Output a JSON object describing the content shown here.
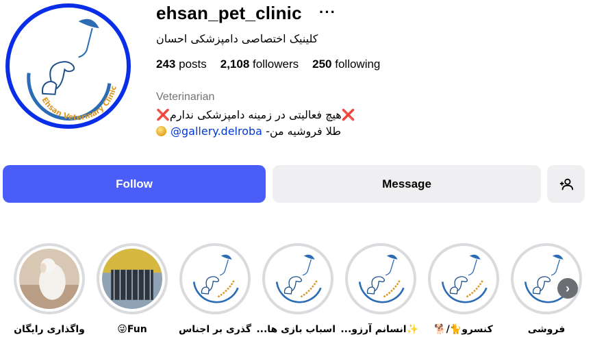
{
  "profile": {
    "username": "ehsan_pet_clinic",
    "more_icon": "more-horizontal-icon",
    "full_name": "کلینیک اختصاصی دامپزشکی احسان",
    "avatar_text": "Ehsan Veterinary Clinic"
  },
  "stats": {
    "posts_count": "243",
    "posts_label": "posts",
    "followers_count": "2,108",
    "followers_label": "followers",
    "following_count": "250",
    "following_label": "following"
  },
  "bio": {
    "category": "Veterinarian",
    "line1_text": "هیچ فعالیتی در زمینه دامپزشکی ندارم",
    "line1_mark": "❌",
    "line2_text": "طلا فروشیه من-",
    "line2_link": "@gallery.delroba"
  },
  "actions": {
    "follow_label": "Follow",
    "message_label": "Message",
    "add_user_icon": "add-user-icon"
  },
  "highlights": [
    {
      "label": "واگذاری رایگان",
      "thumb": "photo-dog"
    },
    {
      "label": "Fun😜",
      "thumb": "photo-cage"
    },
    {
      "label": "گذری بر اجناس",
      "thumb": "clinic-logo"
    },
    {
      "label": "اسباب بازی ها...",
      "thumb": "clinic-logo"
    },
    {
      "label": "✨انسانم آرزو...",
      "thumb": "clinic-logo"
    },
    {
      "label": "کنسرو🐈/🐕",
      "thumb": "clinic-logo"
    },
    {
      "label": "فروشی",
      "thumb": "clinic-logo"
    }
  ],
  "colors": {
    "follow_button": "#4a5df9",
    "avatar_ring": "#0a2ee8",
    "link": "#0038d1"
  }
}
